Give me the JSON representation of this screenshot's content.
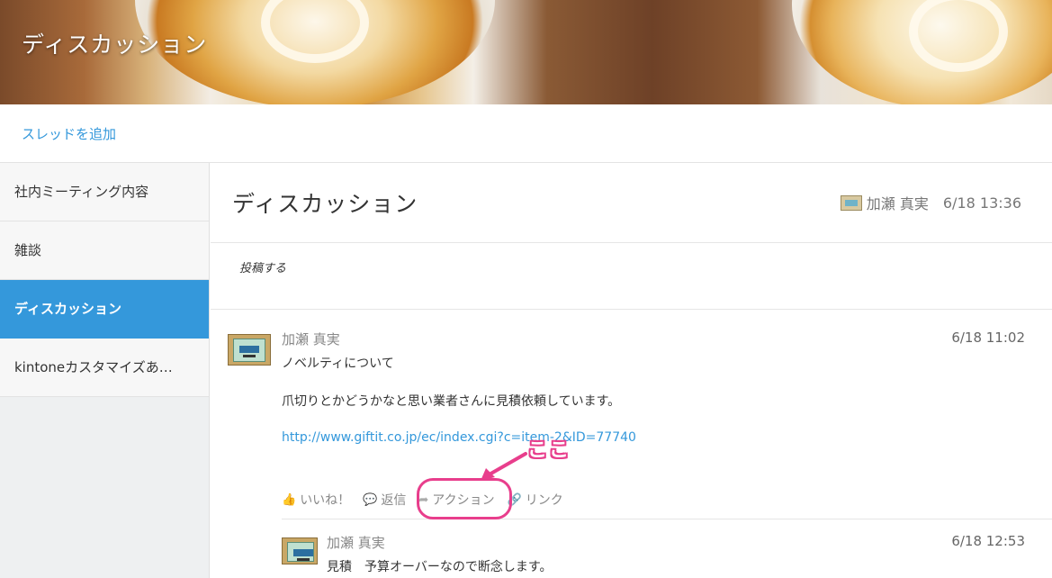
{
  "banner": {
    "title": "ディスカッション"
  },
  "toolbar": {
    "add_thread": "スレッドを追加"
  },
  "sidebar": {
    "items": [
      {
        "label": "社内ミーティング内容",
        "active": false
      },
      {
        "label": "雑談",
        "active": false
      },
      {
        "label": "ディスカッション",
        "active": true
      },
      {
        "label": "kintoneカスタマイズあ…",
        "active": false
      }
    ]
  },
  "thread": {
    "title": "ディスカッション",
    "author": "加瀬 真実",
    "date": "6/18 13:36",
    "post_placeholder": "投稿する"
  },
  "comment": {
    "author": "加瀬 真実",
    "date": "6/18 11:02",
    "subject": "ノベルティについて",
    "body": "爪切りとかどうかなと思い業者さんに見積依頼しています。",
    "link": "http://www.giftit.co.jp/ec/index.cgi?c=item-2&ID=77740",
    "actions": {
      "like": "いいね！",
      "reply": "返信",
      "action": "アクション",
      "link": "リンク"
    }
  },
  "reply": {
    "author": "加瀬 真実",
    "date": "6/18 12:53",
    "body": "見積　予算オーバーなので断念します。"
  },
  "annotation": {
    "text": "ここ",
    "color": "#e83e8c"
  },
  "colors": {
    "accent": "#3498db",
    "annotation": "#e83e8c"
  }
}
